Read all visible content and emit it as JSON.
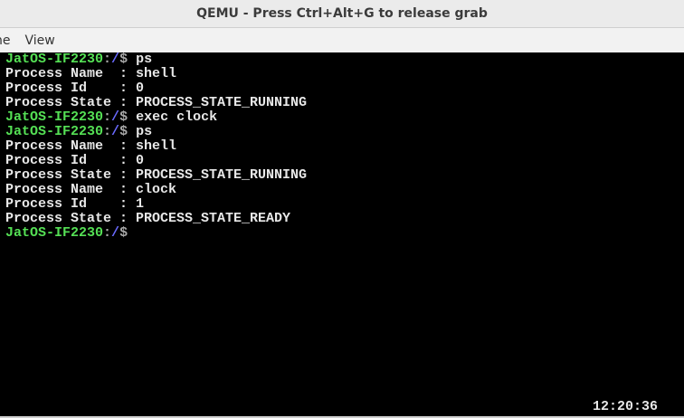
{
  "window": {
    "title": "QEMU - Press Ctrl+Alt+G to release grab"
  },
  "menu": [
    "Machine",
    "View"
  ],
  "menu_visible": [
    "ne",
    "View"
  ],
  "prompt": {
    "host": "JatOS-IF2230",
    "sep": ":",
    "path": "/",
    "symbol": "$"
  },
  "lines": [
    {
      "type": "prompt",
      "cmd": " ps"
    },
    {
      "type": "out",
      "text": "Process Name  : shell"
    },
    {
      "type": "out",
      "text": "Process Id    : 0"
    },
    {
      "type": "out",
      "text": "Process State : PROCESS_STATE_RUNNING"
    },
    {
      "type": "prompt",
      "cmd": " exec clock"
    },
    {
      "type": "prompt",
      "cmd": " ps"
    },
    {
      "type": "out",
      "text": "Process Name  : shell"
    },
    {
      "type": "out",
      "text": "Process Id    : 0"
    },
    {
      "type": "out",
      "text": "Process State : PROCESS_STATE_RUNNING"
    },
    {
      "type": "out",
      "text": "Process Name  : clock"
    },
    {
      "type": "out",
      "text": "Process Id    : 1"
    },
    {
      "type": "out",
      "text": "Process State : PROCESS_STATE_READY"
    },
    {
      "type": "prompt",
      "cmd": ""
    }
  ],
  "clock": "12:20:36"
}
